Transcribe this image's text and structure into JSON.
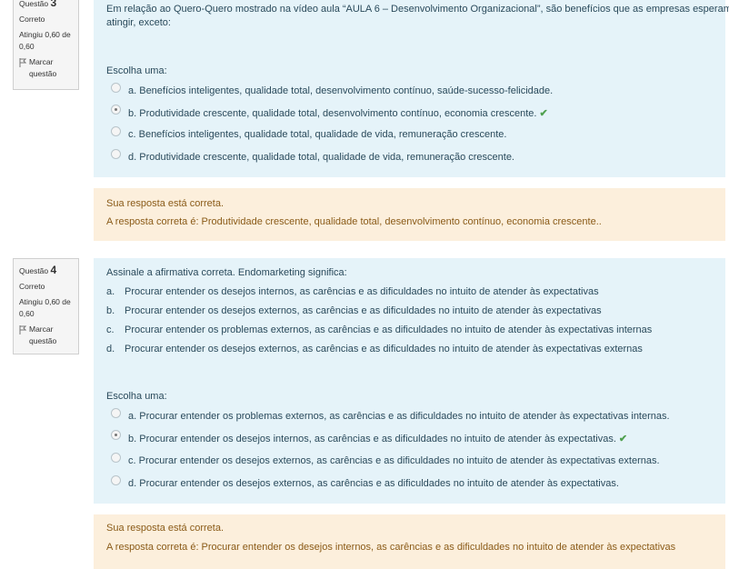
{
  "q3": {
    "info": {
      "label": "Questão",
      "number": "3",
      "state": "Correto",
      "grade": "Atingiu 0,60 de 0,60",
      "flag": "Marcar questão"
    },
    "question_line1": "Em relação ao Quero-Quero mostrado na vídeo aula “AULA 6 – Desenvolvimento Organizacional”, são benefícios que as empresas esperam",
    "question_line2": "atingir, exceto:",
    "choose_label": "Escolha uma:",
    "options": [
      {
        "text": "a. Benefícios inteligentes, qualidade total, desenvolvimento contínuo, saúde-sucesso-felicidade.",
        "selected": false,
        "correct": false
      },
      {
        "text": "b. Produtividade crescente, qualidade total, desenvolvimento contínuo, economia crescente.",
        "selected": true,
        "correct": true
      },
      {
        "text": "c. Benefícios inteligentes, qualidade total, qualidade de vida, remuneração crescente.",
        "selected": false,
        "correct": false
      },
      {
        "text": "d. Produtividade crescente, qualidade total, qualidade de vida, remuneração crescente.",
        "selected": false,
        "correct": false
      }
    ],
    "feedback": {
      "status": "Sua resposta está correta.",
      "answer": "A resposta correta é: Produtividade crescente, qualidade total, desenvolvimento contínuo, economia crescente.."
    }
  },
  "q4": {
    "info": {
      "label": "Questão",
      "number": "4",
      "state": "Correto",
      "grade": "Atingiu 0,60 de 0,60",
      "flag": "Marcar questão"
    },
    "question": "Assinale a afirmativa correta. Endomarketing significa:",
    "statements": [
      {
        "letter": "a.",
        "text": "Procurar entender os desejos internos, as carências e as dificuldades no intuito de atender às expectativas"
      },
      {
        "letter": "b.",
        "text": "Procurar entender os desejos externos, as carências e as dificuldades no intuito de atender às expectativas"
      },
      {
        "letter": "c.",
        "text": "Procurar entender os problemas externos, as carências e as dificuldades no intuito de atender às expectativas internas"
      },
      {
        "letter": "d.",
        "text": "Procurar entender os desejos externos, as carências e as dificuldades no intuito de atender às expectativas externas"
      }
    ],
    "choose_label": "Escolha uma:",
    "options": [
      {
        "text": "a. Procurar entender os problemas externos, as carências e as dificuldades no intuito de atender às expectativas internas.",
        "selected": false,
        "correct": false
      },
      {
        "text": "b. Procurar entender os desejos internos, as carências e as dificuldades no intuito de atender às expectativas.",
        "selected": true,
        "correct": true
      },
      {
        "text": "c. Procurar entender os desejos externos, as carências e as dificuldades no intuito de atender às expectativas externas.",
        "selected": false,
        "correct": false
      },
      {
        "text": "d. Procurar entender os desejos externos, as carências e as dificuldades no intuito de atender às expectativas.",
        "selected": false,
        "correct": false
      }
    ],
    "feedback": {
      "status": "Sua resposta está correta.",
      "answer": "A resposta correta é: Procurar entender os desejos internos, as carências e as dificuldades no intuito de atender às expectativas"
    }
  },
  "icons": {
    "correct": "check-icon",
    "flag": "flag-icon"
  },
  "colors": {
    "question_bg": "#e5f3f9",
    "feedback_bg": "#fcefdc",
    "info_bg": "#f5f5f5",
    "correct_check": "#4fa04f"
  }
}
